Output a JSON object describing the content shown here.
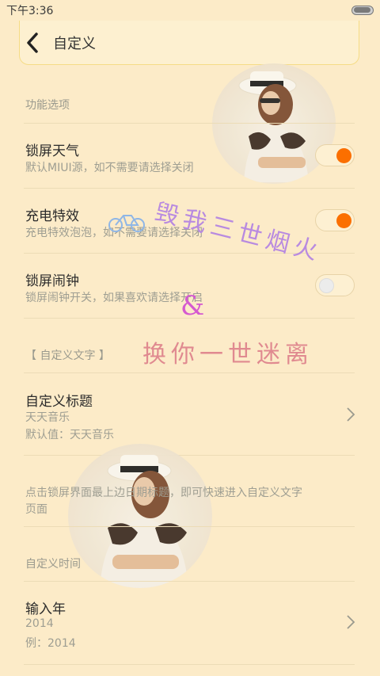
{
  "status": {
    "time": "下午3:36"
  },
  "header": {
    "title": "自定义"
  },
  "sections": {
    "features": "功能选项",
    "custom_text": "【 自定义文字 】",
    "custom_time": "自定义时间"
  },
  "rows": {
    "lock_weather": {
      "title": "锁屏天气",
      "subtitle": "默认MIUI源，如不需要请选择关闭",
      "enabled": true
    },
    "charging_effect": {
      "title": "充电特效",
      "subtitle": "充电特效泡泡，如不需要请选择关闭",
      "enabled": true
    },
    "lock_alarm": {
      "title": "锁屏闹钟",
      "subtitle": "锁屏闹钟开关，如果喜欢请选择开启",
      "enabled": false
    },
    "custom_title": {
      "title": "自定义标题",
      "value": "天天音乐",
      "default": "默认值：天天音乐"
    },
    "input_year": {
      "title": "输入年",
      "value": "2014",
      "example": "例：2014"
    }
  },
  "hint": {
    "line1": "点击锁屏界面最上边日期标题，即可快速进入自定义文字",
    "line2": "页面"
  },
  "decor": {
    "line1": "毁我三世烟火",
    "amp": "&",
    "line2": "换你一世迷离"
  },
  "colors": {
    "background": "#fcebc8",
    "accent": "#fb6f00"
  }
}
